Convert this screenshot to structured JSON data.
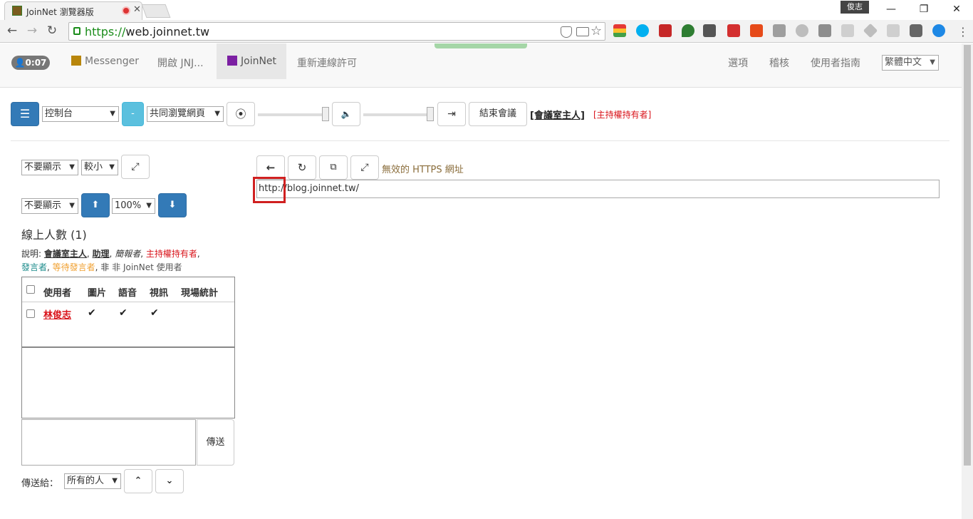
{
  "browser": {
    "tab_title": "JoinNet 瀏覽器版",
    "user_chip": "俊志",
    "url_scheme": "https://",
    "url_host": "web.joinnet.tw"
  },
  "navbar": {
    "timer": "0:07",
    "links": [
      "Messenger",
      "開啟 JNJ...",
      "JoinNet",
      "重新連線許可"
    ],
    "right_links": [
      "選項",
      "稽核",
      "使用者指南"
    ],
    "language": "繁體中文"
  },
  "controls": {
    "menu_select": "控制台",
    "minus_label": "-",
    "mode_select": "共同瀏覽網頁",
    "end_meeting": "結束會議",
    "role": "[會議室主人]",
    "role_extra": "[主持權持有者]"
  },
  "left": {
    "display_select_1": "不要顯示",
    "size_select": "較小",
    "display_select_2": "不要顯示",
    "zoom_select": "100%",
    "online_title": "線上人數 (1)",
    "legend_prefix": "說明:",
    "legend_owner": "會議室主人",
    "legend_assistant": "助理",
    "legend_reporter": "簡報者",
    "legend_host": "主持權持有者",
    "legend_speaker": "發言者",
    "legend_waiting": "等待發言者",
    "legend_tail": "非 JoinNet 使用者",
    "columns": [
      "使用者",
      "圖片",
      "語音",
      "視訊",
      "現場統計"
    ],
    "users": [
      {
        "name": "林俊志",
        "picture": "✔",
        "voice": "✔",
        "video": "✔"
      }
    ],
    "send_button": "傳送",
    "send_to_label": "傳送給：",
    "send_to_select": "所有的人"
  },
  "cobrowse": {
    "warning": "無效的 HTTPS 網址",
    "url": "http://blog.joinnet.tw/"
  },
  "colors": {
    "primary": "#337ab7",
    "info": "#5bc0de",
    "host_red": "#d9141b",
    "speaker_teal": "#1a8a8a",
    "waiting_orange": "#f0a030"
  }
}
